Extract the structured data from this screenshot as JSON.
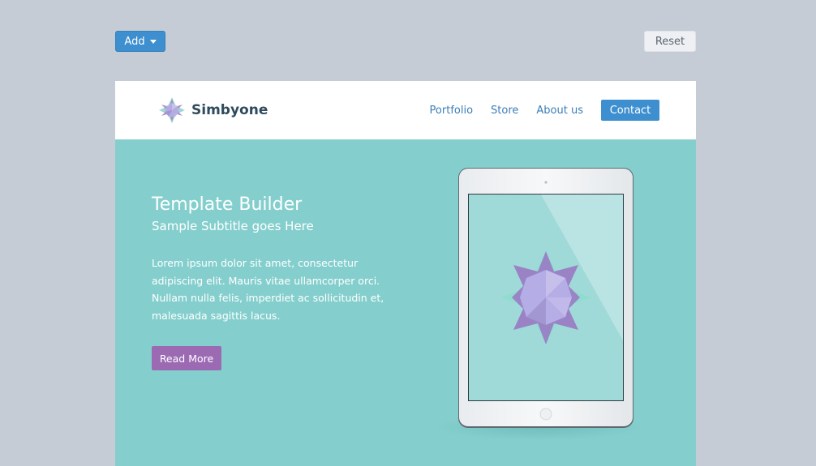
{
  "toolbar": {
    "add_label": "Add",
    "reset_label": "Reset"
  },
  "site": {
    "brand_name": "Simbyone",
    "nav": [
      {
        "label": "Portfolio"
      },
      {
        "label": "Store"
      },
      {
        "label": "About us"
      }
    ],
    "contact_label": "Contact"
  },
  "hero": {
    "title": "Template Builder",
    "subtitle": "Sample Subtitle goes Here",
    "body": "Lorem ipsum dolor sit amet, consectetur adipiscing elit. Mauris vitae ullamcorper orci. Nullam nulla felis, imperdiet ac sollicitudin et, malesuada sagittis lacus.",
    "cta_label": "Read More"
  },
  "colors": {
    "page_background": "#c5ccd6",
    "accent_blue": "#3d8fcf",
    "hero_teal": "#84cfcd",
    "cta_purple": "#9b6ab3",
    "brand_text": "#2f4a5c"
  },
  "icons": {
    "add_caret": "caret-down-icon",
    "logo": "star-logo-icon",
    "device_graphic": "star-graphic-icon"
  }
}
